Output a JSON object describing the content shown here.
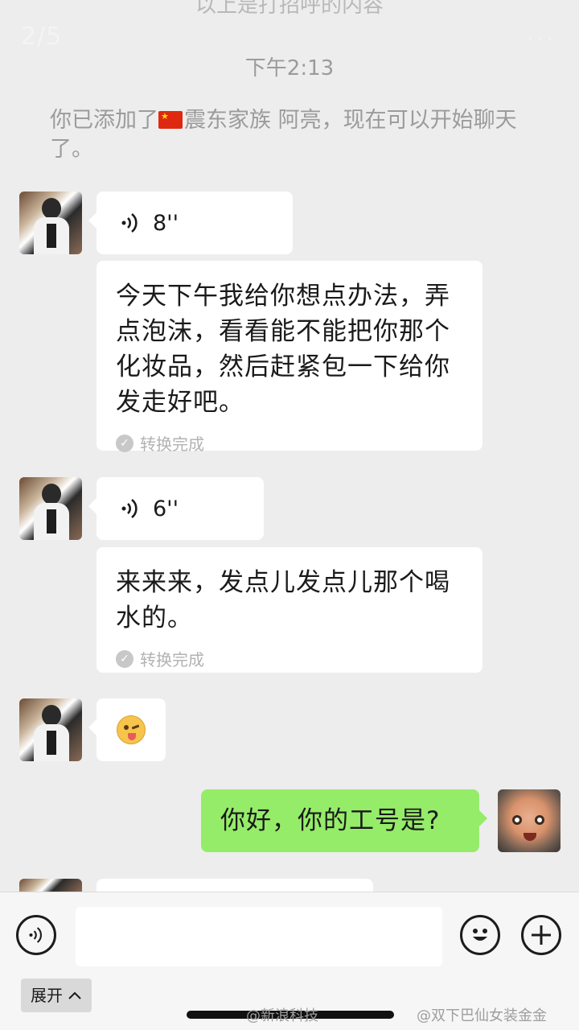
{
  "header": {
    "cut_text": "以上是打招呼的内容",
    "page_indicator": "2/5",
    "more_label": "···"
  },
  "chat": {
    "timestamp": "下午2:13",
    "system_message": {
      "prefix": "你已添加了",
      "flag_icon": "china-flag",
      "name": "震东家族 阿亮",
      "suffix": "，现在可以开始聊天了。"
    },
    "messages": [
      {
        "sender": "contact",
        "type": "voice",
        "duration": "8''"
      },
      {
        "sender": "contact",
        "type": "transcript",
        "text": "今天下午我给你想点办法，弄点泡沫，看看能不能把你那个化妆品，然后赶紧包一下给你发走好吧。",
        "status": "转换完成"
      },
      {
        "sender": "contact",
        "type": "voice",
        "duration": "6''"
      },
      {
        "sender": "contact",
        "type": "transcript",
        "text": "来来来，发点儿发点儿那个喝水的。",
        "status": "转换完成"
      },
      {
        "sender": "contact",
        "type": "emoji",
        "icon": "wink-tongue-emoji"
      },
      {
        "sender": "me",
        "type": "text",
        "text": "你好，你的工号是?"
      }
    ]
  },
  "input_bar": {
    "voice_icon": "voice-input-icon",
    "emoji_icon": "smiley-icon",
    "plus_icon": "plus-icon",
    "expand_label": "展开",
    "input_value": ""
  },
  "watermarks": {
    "left": "@新浪科技",
    "right": "@双下巴仙女装金金"
  },
  "colors": {
    "background": "#ededed",
    "bubble_incoming": "#ffffff",
    "bubble_outgoing": "#95ec69",
    "meta_text": "#9b9b9b"
  }
}
